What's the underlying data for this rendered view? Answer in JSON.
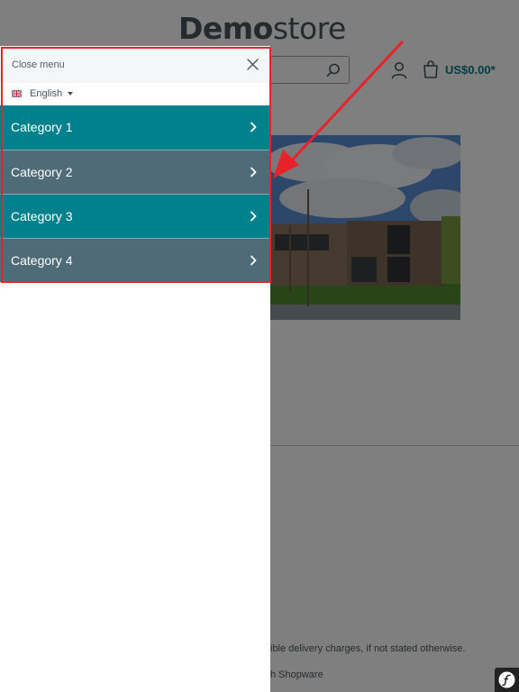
{
  "header": {
    "logo_bold": "Demo",
    "logo_light": "store",
    "cart_total": "US$0.00*"
  },
  "footer": {
    "shipping_note": "ible delivery charges, if not stated otherwise.",
    "realized_by": "h Shopware"
  },
  "offcanvas": {
    "close_label": "Close menu",
    "language": {
      "selected": "English"
    },
    "categories": [
      {
        "label": "Category 1",
        "color": "#01818b"
      },
      {
        "label": "Category 2",
        "color": "#4e6b77"
      },
      {
        "label": "Category 3",
        "color": "#01818b"
      },
      {
        "label": "Category 4",
        "color": "#4e6b77"
      }
    ]
  },
  "colors": {
    "accent": "#0b7a89",
    "annotation": "#e8222a"
  }
}
